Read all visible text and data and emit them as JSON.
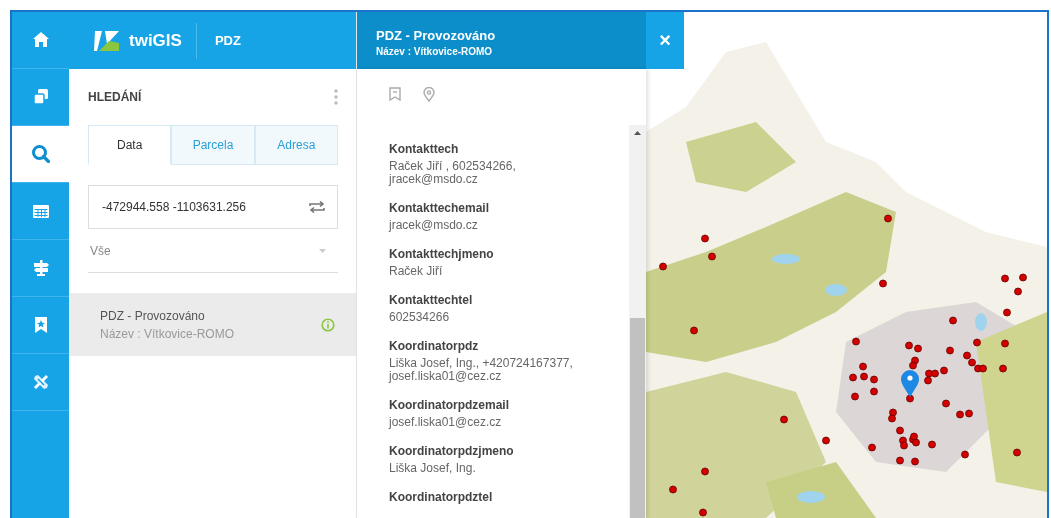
{
  "nav": [
    {
      "kind": "home",
      "selected": false
    },
    {
      "kind": "layers",
      "selected": false
    },
    {
      "kind": "search",
      "selected": true
    },
    {
      "kind": "table",
      "selected": false
    },
    {
      "kind": "signpost",
      "selected": false
    },
    {
      "kind": "bookmark",
      "selected": false
    },
    {
      "kind": "tools",
      "selected": false
    }
  ],
  "app": {
    "logo": "twiGIS",
    "module": "PDZ"
  },
  "search_panel": {
    "title": "HLEDÁNÍ",
    "tabs": [
      {
        "label": "Data",
        "selected": true
      },
      {
        "label": "Parcela",
        "selected": false
      },
      {
        "label": "Adresa",
        "selected": false
      }
    ],
    "query": "-472944.558 -1103631.256",
    "filter": "Vše",
    "results": [
      {
        "title": "PDZ - Provozováno",
        "subtitle": "Název : Vítkovice-ROMO",
        "selected": true
      }
    ]
  },
  "detail": {
    "title": "PDZ - Provozováno",
    "subtitle": "Název : Vítkovice-ROMO",
    "close": "×",
    "fields": [
      {
        "label": "Kontakttech",
        "value": "Raček Jiří , 602534266, jracek@msdo.cz"
      },
      {
        "label": "Kontakttechemail",
        "value": "jracek@msdo.cz"
      },
      {
        "label": "Kontakttechjmeno",
        "value": "Raček Jiří"
      },
      {
        "label": "Kontakttechtel",
        "value": "602534266"
      },
      {
        "label": "Koordinatorpdz",
        "value": "Liška Josef, Ing., +420724167377, josef.liska01@cez.cz"
      },
      {
        "label": "Koordinatorpdzemail",
        "value": "josef.liska01@cez.cz"
      },
      {
        "label": "Koordinatorpdzjmeno",
        "value": "Liška Josef, Ing."
      },
      {
        "label": "Koordinatorpdztel"
      }
    ]
  }
}
